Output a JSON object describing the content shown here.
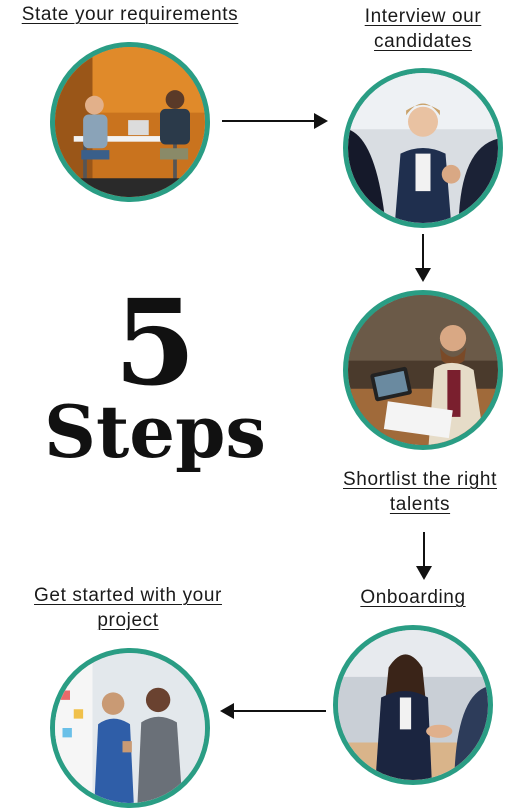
{
  "headline": {
    "number": "5",
    "word": "Steps"
  },
  "steps": [
    {
      "label": "State your requirements"
    },
    {
      "label": "Interview our candidates"
    },
    {
      "label": "Shortlist the right talents"
    },
    {
      "label": "Onboarding"
    },
    {
      "label": "Get started with your project"
    }
  ],
  "colors": {
    "ring": "#2a9d84",
    "text": "#1a1a1a",
    "arrow": "#111111"
  },
  "icons": [
    "arrow-right-icon",
    "arrow-down-icon",
    "arrow-down-icon",
    "arrow-left-icon"
  ]
}
